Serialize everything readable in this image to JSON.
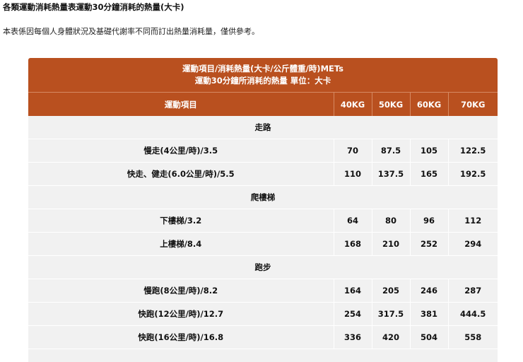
{
  "page": {
    "title": "各類運動消耗熱量表運動30分鐘消耗的熱量(大卡)",
    "note": "本表係因每個人身體狀況及基礎代謝率不同而訂出熱量消耗量，僅供參考。"
  },
  "table": {
    "caption_line1": "運動項目/消耗熱量(大卡/公斤體重/時)METs",
    "caption_line2": "運動30分鐘所消耗的熱量 單位：大卡",
    "header": {
      "item": "運動項目",
      "w40": "40KG",
      "w50": "50KG",
      "w60": "60KG",
      "w70": "70KG"
    },
    "groups": [
      {
        "name": "走路",
        "rows": [
          {
            "item": "慢走(4公里/時)/3.5",
            "w40": "70",
            "w50": "87.5",
            "w60": "105",
            "w70": "122.5"
          },
          {
            "item": "快走、健走(6.0公里/時)/5.5",
            "w40": "110",
            "w50": "137.5",
            "w60": "165",
            "w70": "192.5"
          }
        ]
      },
      {
        "name": "爬樓梯",
        "rows": [
          {
            "item": "下樓梯/3.2",
            "w40": "64",
            "w50": "80",
            "w60": "96",
            "w70": "112"
          },
          {
            "item": "上樓梯/8.4",
            "w40": "168",
            "w50": "210",
            "w60": "252",
            "w70": "294"
          }
        ]
      },
      {
        "name": "跑步",
        "rows": [
          {
            "item": "慢跑(8公里/時)/8.2",
            "w40": "164",
            "w50": "205",
            "w60": "246",
            "w70": "287"
          },
          {
            "item": "快跑(12公里/時)/12.7",
            "w40": "254",
            "w50": "317.5",
            "w60": "381",
            "w70": "444.5"
          },
          {
            "item": "快跑(16公里/時)/16.8",
            "w40": "336",
            "w50": "420",
            "w60": "504",
            "w70": "558"
          }
        ]
      }
    ]
  },
  "colors": {
    "header_bg": "#b9501f",
    "row_bg": "#f1f1f1"
  }
}
